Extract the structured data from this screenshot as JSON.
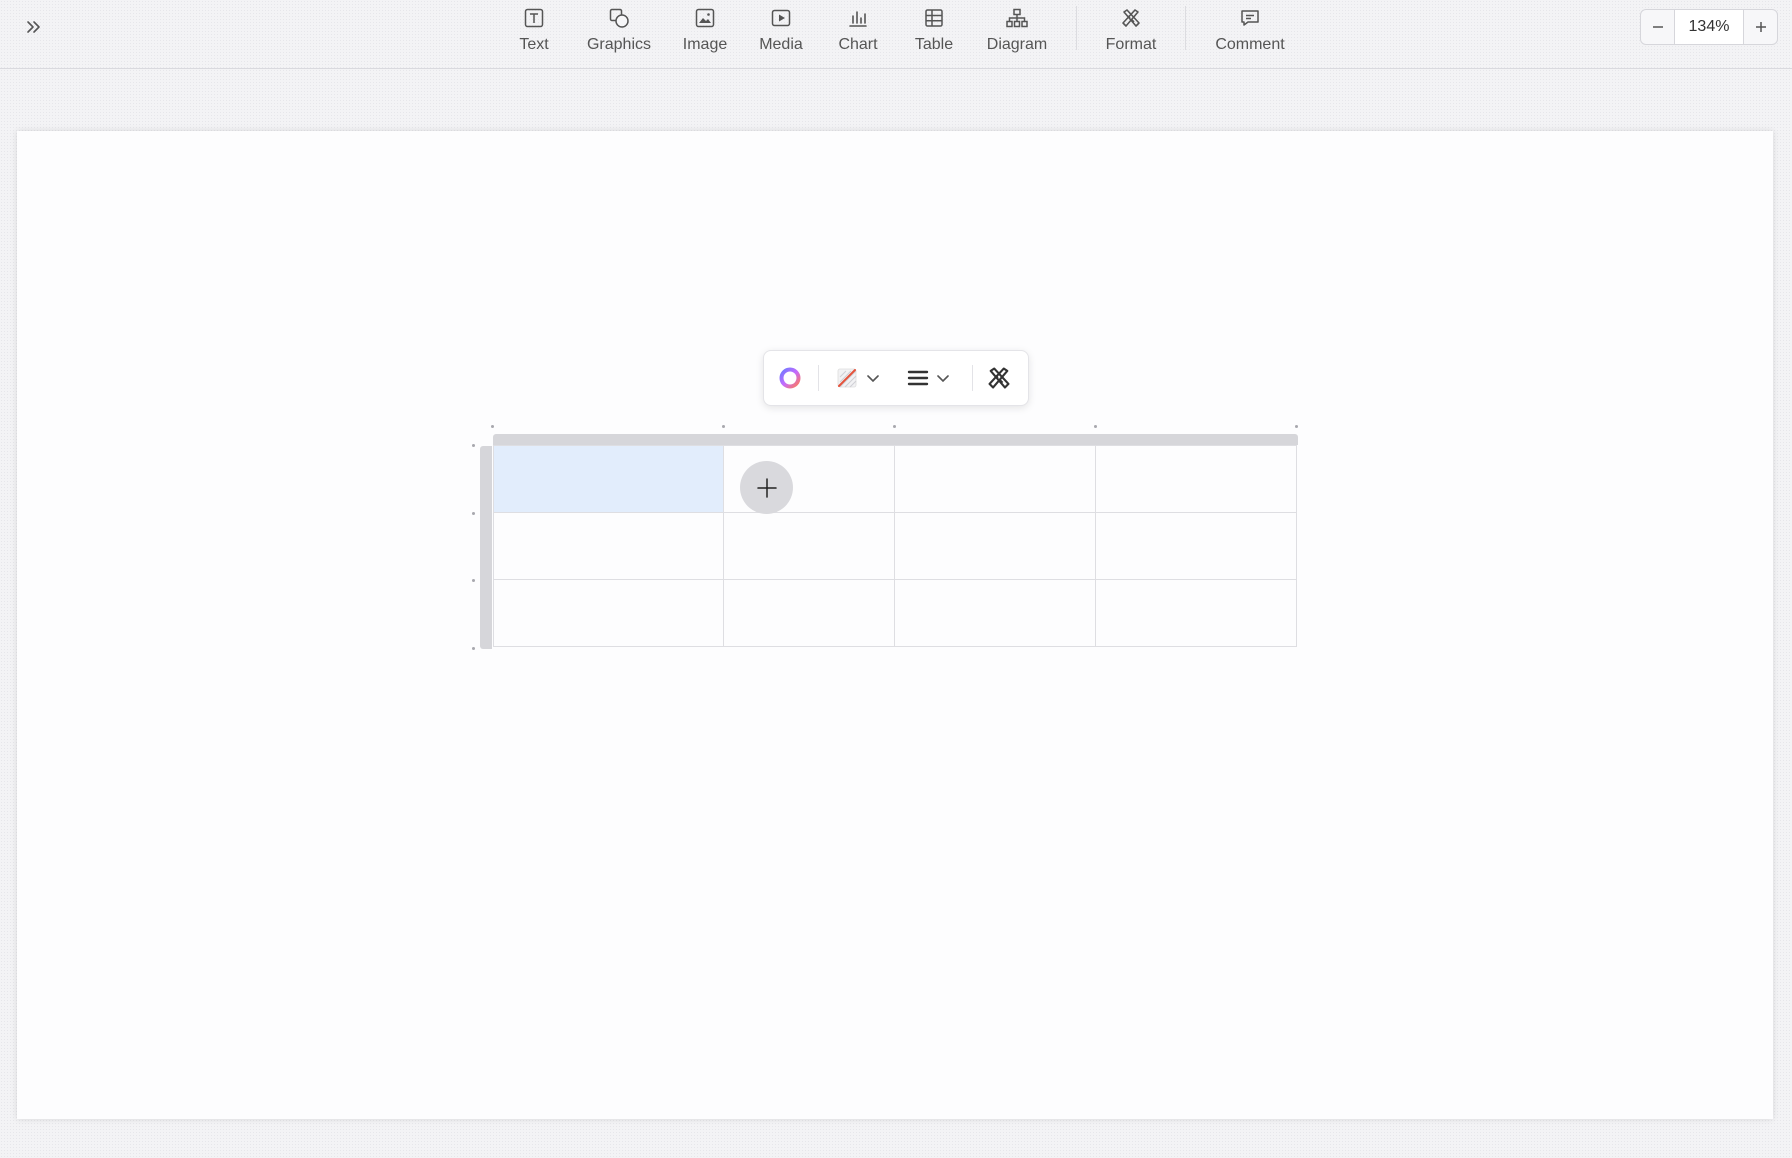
{
  "toolbar": {
    "items": [
      {
        "label": "Text",
        "icon": "text-icon"
      },
      {
        "label": "Graphics",
        "icon": "graphics-icon"
      },
      {
        "label": "Image",
        "icon": "image-icon"
      },
      {
        "label": "Media",
        "icon": "media-icon"
      },
      {
        "label": "Chart",
        "icon": "chart-icon"
      },
      {
        "label": "Table",
        "icon": "table-icon"
      },
      {
        "label": "Diagram",
        "icon": "diagram-icon"
      },
      {
        "label": "Format",
        "icon": "format-icon"
      },
      {
        "label": "Comment",
        "icon": "comment-icon"
      }
    ]
  },
  "zoom": {
    "value": "134%"
  },
  "table": {
    "rows": 3,
    "columns": 4,
    "selected_cell": {
      "row": 1,
      "column": 1
    },
    "selection_color": "#e2edfc"
  },
  "colors": {
    "accent_gradient": [
      "#7b61ff",
      "#ff7a59"
    ],
    "border": "#d2d2d6"
  }
}
